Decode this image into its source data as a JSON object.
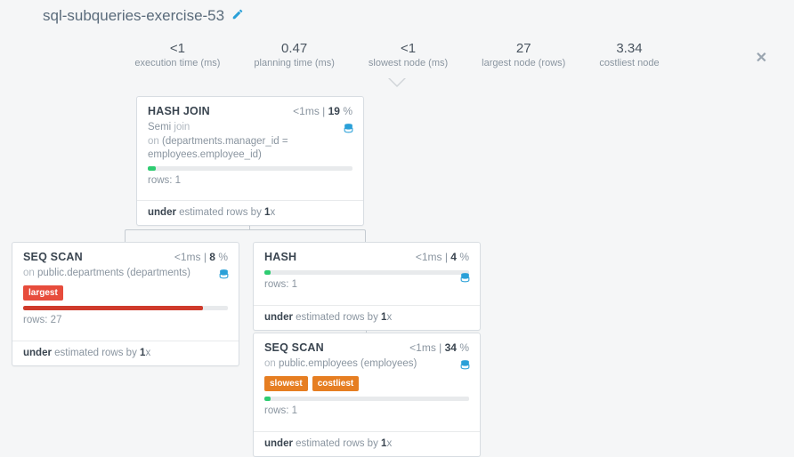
{
  "title": "sql-subqueries-exercise-53",
  "stats": {
    "exec_time": {
      "value": "<1",
      "label": "execution time (ms)"
    },
    "plan_time": {
      "value": "0.47",
      "label": "planning time (ms)"
    },
    "slowest": {
      "value": "<1",
      "label": "slowest node (ms)"
    },
    "largest": {
      "value": "27",
      "label": "largest node (rows)"
    },
    "costliest": {
      "value": "3.34",
      "label": "costliest node"
    }
  },
  "nodes": {
    "hash_join": {
      "title": "HASH JOIN",
      "time": "<1",
      "time_unit": "ms",
      "pct": "19",
      "kind_prefix": "Semi ",
      "kind_word": "join",
      "cond_prefix": "on ",
      "cond": "(departments.manager_id = employees.employee_id)",
      "rows_label": "rows: ",
      "rows": "1",
      "est_prefix": "under",
      "est_mid": " estimated rows by ",
      "est_factor": "1",
      "est_suffix": "x",
      "bar_pct": 4
    },
    "seq_scan_dept": {
      "title": "SEQ SCAN",
      "time": "<1",
      "time_unit": "ms",
      "pct": "8",
      "on_prefix": "on ",
      "on": "public.departments (departments)",
      "tag_largest": "largest",
      "rows_label": "rows: ",
      "rows": "27",
      "est_prefix": "under",
      "est_mid": " estimated rows by ",
      "est_factor": "1",
      "est_suffix": "x",
      "bar_pct": 88
    },
    "hash": {
      "title": "HASH",
      "time": "<1",
      "time_unit": "ms",
      "pct": "4",
      "rows_label": "rows: ",
      "rows": "1",
      "est_prefix": "under",
      "est_mid": " estimated rows by ",
      "est_factor": "1",
      "est_suffix": "x",
      "bar_pct": 3
    },
    "seq_scan_emp": {
      "title": "SEQ SCAN",
      "time": "<1",
      "time_unit": "ms",
      "pct": "34",
      "on_prefix": "on ",
      "on": "public.employees (employees)",
      "tag_slowest": "slowest",
      "tag_costliest": "costliest",
      "rows_label": "rows: ",
      "rows": "1",
      "est_prefix": "under",
      "est_mid": " estimated rows by ",
      "est_factor": "1",
      "est_suffix": "x",
      "bar_pct": 3
    }
  }
}
